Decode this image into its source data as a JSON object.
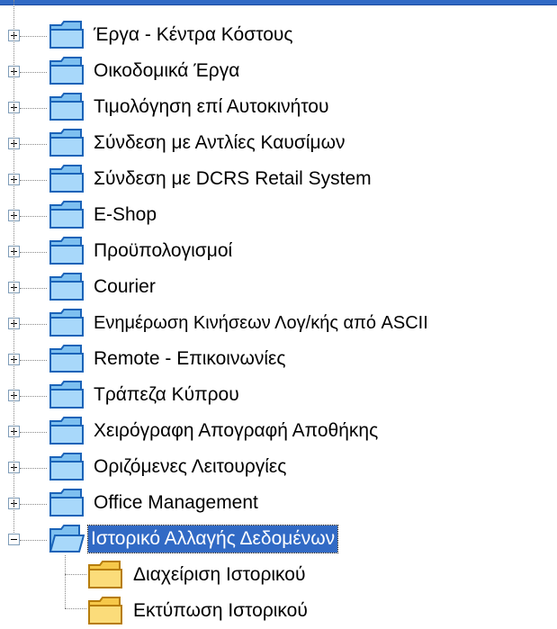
{
  "tree": {
    "items": [
      {
        "label": "Έργα - Κέντρα Κόστους",
        "expander": "plus",
        "icon": "folder-blue-icon"
      },
      {
        "label": "Οικοδομικά Έργα",
        "expander": "plus",
        "icon": "folder-blue-icon"
      },
      {
        "label": "Τιμολόγηση επί Αυτοκινήτου",
        "expander": "plus",
        "icon": "folder-blue-icon"
      },
      {
        "label": "Σύνδεση με Αντλίες Καυσίμων",
        "expander": "plus",
        "icon": "folder-blue-icon"
      },
      {
        "label": "Σύνδεση με DCRS Retail System",
        "expander": "plus",
        "icon": "folder-blue-icon"
      },
      {
        "label": "E-Shop",
        "expander": "plus",
        "icon": "folder-blue-icon"
      },
      {
        "label": "Προϋπολογισμοί",
        "expander": "plus",
        "icon": "folder-blue-icon"
      },
      {
        "label": "Courier",
        "expander": "plus",
        "icon": "folder-blue-icon"
      },
      {
        "label": "Ενημέρωση Κινήσεων Λογ/κής από ASCII",
        "expander": "plus",
        "icon": "folder-blue-icon"
      },
      {
        "label": "Remote - Επικοινωνίες",
        "expander": "plus",
        "icon": "folder-blue-icon"
      },
      {
        "label": "Τράπεζα Κύπρου",
        "expander": "plus",
        "icon": "folder-blue-icon"
      },
      {
        "label": "Χειρόγραφη Απογραφή Αποθήκης",
        "expander": "plus",
        "icon": "folder-blue-icon"
      },
      {
        "label": "Οριζόμενες Λειτουργίες",
        "expander": "plus",
        "icon": "folder-blue-icon"
      },
      {
        "label": "Office Management",
        "expander": "plus",
        "icon": "folder-blue-icon"
      },
      {
        "label": "Ιστορικό Αλλαγής Δεδομένων",
        "expander": "minus",
        "icon": "folder-blue-open-icon",
        "selected": true
      },
      {
        "label": "Διαχείριση Ιστορικού",
        "child": true,
        "icon": "folder-yellow-icon"
      },
      {
        "label": "Εκτύπωση Ιστορικού",
        "child": true,
        "icon": "folder-yellow-icon"
      }
    ]
  },
  "colors": {
    "selection": "#316ac5",
    "folder_blue": "#7ec0f0",
    "folder_yellow": "#f6c84a"
  }
}
